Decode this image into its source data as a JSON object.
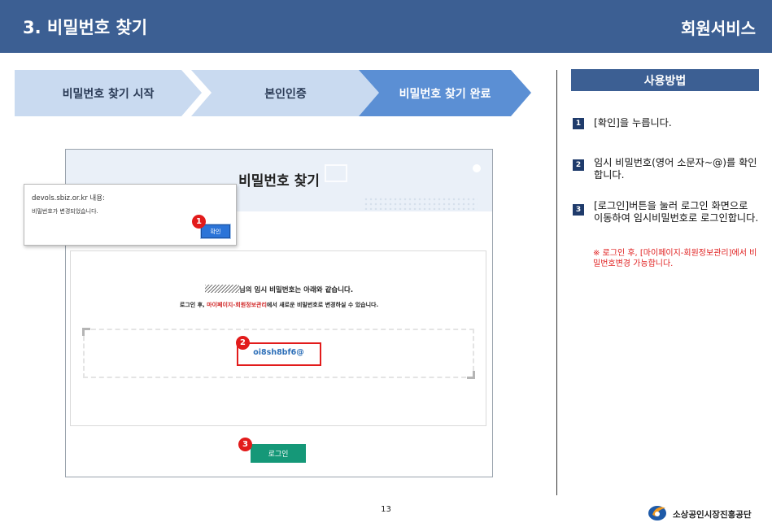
{
  "header": {
    "title": "3. 비밀번호 찾기",
    "service": "회원서비스"
  },
  "steps": [
    {
      "label": "비밀번호 찾기 시작"
    },
    {
      "label": "본인인증"
    },
    {
      "label": "비밀번호 찾기 완료"
    }
  ],
  "screenshot": {
    "page_title": "비밀번호 찾기",
    "dialog": {
      "host": "devols.sbiz.or.kr 내용:",
      "message": "비밀번호가 변경되었습니다.",
      "ok_label": "확인"
    },
    "line1_suffix": "님의 임시 비밀번호는 아래와 같습니다.",
    "line2_prefix": "로그인 후, ",
    "line2_highlight": "마이페이지-회원정보관리",
    "line2_suffix": "에서 새로운 비밀번호로 변경하실 수 있습니다.",
    "temp_password": "oi8sh8bf6@",
    "login_label": "로그인",
    "badges": [
      "1",
      "2",
      "3"
    ]
  },
  "howto": {
    "title": "사용방법",
    "instructions": [
      {
        "num": "1",
        "text": "[확인]을 누릅니다."
      },
      {
        "num": "2",
        "text": "임시 비밀번호(영어 소문자~@)를 확인합니다."
      },
      {
        "num": "3",
        "text": "[로그인]버튼을 눌러 로그인 화면으로 이동하여 임시비밀번호로 로그인합니다."
      }
    ],
    "note": "※ 로그인 후, [마이페이지-회원정보관리]에서 비밀번호변경 가능합니다."
  },
  "footer": {
    "page_number": "13",
    "org_name": "소상공인시장진흥공단"
  },
  "colors": {
    "header_bg": "#3c5f93",
    "step_inactive": "#c9daf0",
    "step_active": "#5b8fd4",
    "badge_red": "#e21b1b",
    "login_green": "#159878"
  }
}
